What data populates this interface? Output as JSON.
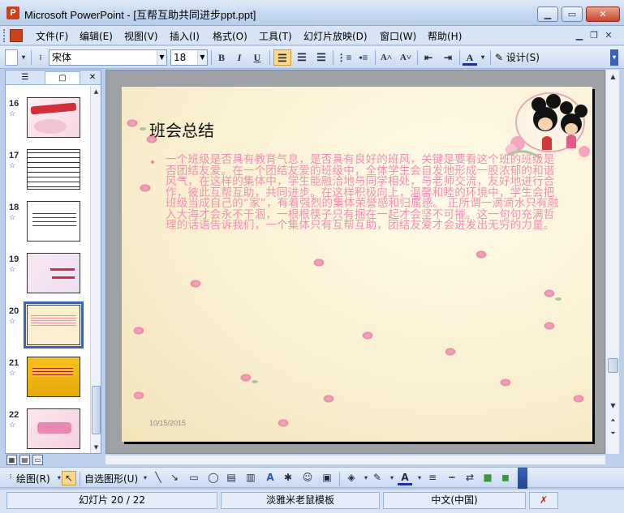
{
  "window": {
    "app_icon_letter": "P",
    "title": "Microsoft PowerPoint - [互帮互助共同进步ppt.ppt]",
    "minimize": "▁",
    "maximize": "▭",
    "close": "✕"
  },
  "menu": {
    "items": [
      "文件(F)",
      "编辑(E)",
      "视图(V)",
      "插入(I)",
      "格式(O)",
      "工具(T)",
      "幻灯片放映(D)",
      "窗口(W)",
      "帮助(H)"
    ],
    "mdi_minimize": "▁",
    "mdi_restore": "❐",
    "mdi_close": "✕"
  },
  "toolbar": {
    "font_name": "宋体",
    "font_size": "18",
    "bold": "B",
    "italic": "I",
    "underline": "U",
    "increase_font": "A˄",
    "decrease_font": "A˅",
    "font_color_label": "A",
    "design_label": "设计(S)"
  },
  "slides_pane": {
    "tab_outline_icon": "☰",
    "tab_slides_icon": "▢",
    "close_icon": "✕",
    "items": [
      {
        "number": "16",
        "star": "☆"
      },
      {
        "number": "17",
        "star": "☆"
      },
      {
        "number": "18",
        "star": "☆"
      },
      {
        "number": "19",
        "star": "☆"
      },
      {
        "number": "20",
        "star": "☆",
        "selected": true
      },
      {
        "number": "21",
        "star": "☆"
      },
      {
        "number": "22",
        "star": "☆"
      }
    ]
  },
  "slide": {
    "title": "班会总结",
    "bullet": "•",
    "body": "一个班级是否具有教育气息，是否具有良好的班风，关键是要看这个班的班级是否团结友爱。在一个团结友爱的班级中，全体学生会自发地形成一股浓郁的和谐风气，在这样的集体中，学生能融洽地与同学相处，与老师交流，友好地进行合作，彼此互帮互助，共同进步。在这样积极向上，温馨和睦的环境中，学生会把班级当成自己的“家”，有着强烈的集体荣誉感和归属感。 正所谓一滴滴水只有融入大海才会永不干涸，一根根筷子只有捆在一起才会坚不可摧。这一句句充满哲理的话语告诉我们，一个集体只有互帮互助，团结友爱才会迸发出无穷的力量。",
    "date": "10/15/2015"
  },
  "drawbar": {
    "draw_label": "绘图(R)",
    "autoshapes_label": "自选图形(U)"
  },
  "status": {
    "slide_position": "幻灯片 20 / 22",
    "template": "淡雅米老鼠模板",
    "language": "中文(中国)"
  },
  "colors": {
    "body_text": "#f58eb5",
    "selection_outline": "#3b62b6",
    "slide_background": "#f9efcf"
  }
}
